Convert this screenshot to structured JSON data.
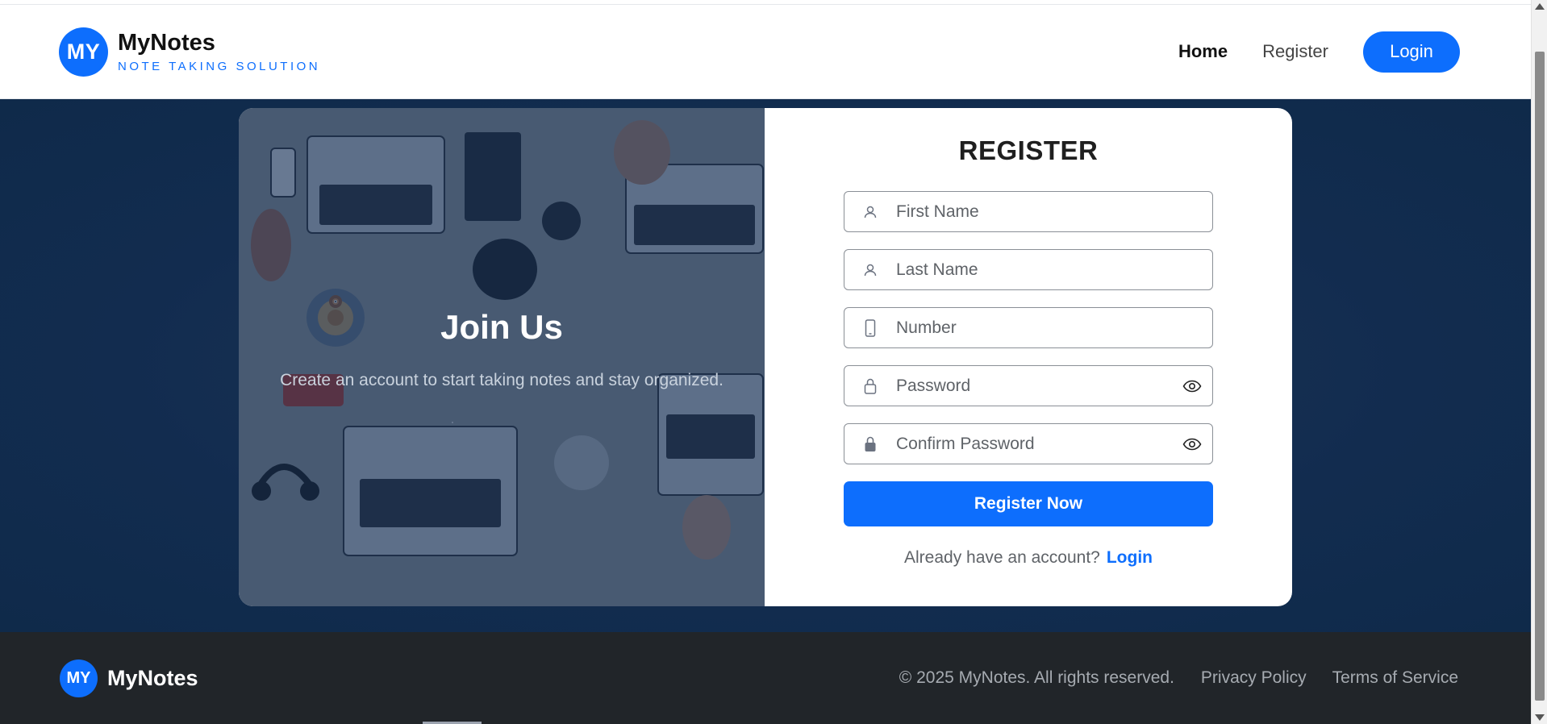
{
  "header": {
    "logo_text": "MY",
    "brand_name": "MyNotes",
    "tagline": "NOTE TAKING SOLUTION",
    "nav": {
      "home": "Home",
      "register": "Register",
      "login": "Login"
    }
  },
  "hero": {
    "title": "Join Us",
    "subtitle": "Create an account to start taking notes and stay organized."
  },
  "form": {
    "title": "REGISTER",
    "first_name_placeholder": "First Name",
    "last_name_placeholder": "Last Name",
    "number_placeholder": "Number",
    "password_placeholder": "Password",
    "confirm_password_placeholder": "Confirm Password",
    "submit_label": "Register Now",
    "already_text": "Already have an account?",
    "login_link": "Login"
  },
  "footer": {
    "logo_text": "MY",
    "brand_name": "MyNotes",
    "copyright": "© 2025 MyNotes. All rights reserved.",
    "privacy": "Privacy Policy",
    "terms": "Terms of Service"
  },
  "colors": {
    "accent": "#0d6efd",
    "hero_bg": "#122c4f",
    "footer_bg": "#212529"
  },
  "icons": [
    "user-icon",
    "phone-icon",
    "lock-open-icon",
    "lock-icon",
    "eye-icon"
  ]
}
